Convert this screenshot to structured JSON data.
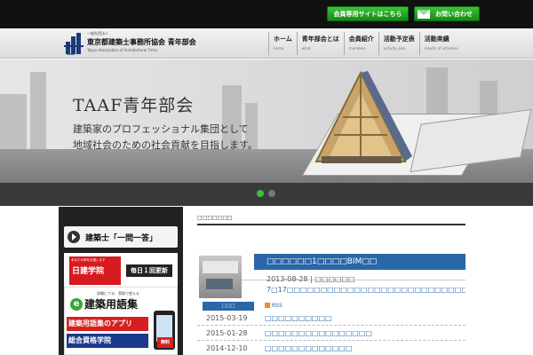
{
  "topbar": {
    "members_label": "会員専用サイトはこちら",
    "contact_label": "お問い合わせ"
  },
  "header": {
    "logo_small": "一般社団法人",
    "logo_title": "東京都建築士事務所協会  青年部会",
    "logo_english": "Tokyo Association of Architectural Firms",
    "logo_abbr": "TAAF"
  },
  "nav": {
    "items": [
      {
        "jp": "ホーム",
        "en": "home"
      },
      {
        "jp": "青年部会とは",
        "en": "what"
      },
      {
        "jp": "会員紹介",
        "en": "members"
      },
      {
        "jp": "活動予定表",
        "en": "activity plan"
      },
      {
        "jp": "活動実績",
        "en": "results of activities"
      }
    ]
  },
  "hero": {
    "title": "TAAF青年部会",
    "subtitle_line1": "建築家のプロフェッショナル集団として",
    "subtitle_line2": "地域社会のための社会貢献を目指します。"
  },
  "sidebar": {
    "banner1_title": "建築士「一問一答」",
    "banner1_small": "あなたの夢を応援します",
    "banner1_brand": "日建学院",
    "banner1_daily": "毎日１回更新",
    "banner2_small": "試験にでる、実務で使える",
    "banner2_e": "e",
    "banner2_title": "建築用語集",
    "banner2_app": "建築用語集のアプリ",
    "banner2_school": "総合資格学院",
    "banner2_free": "無料"
  },
  "main": {
    "section_title": "□□□□□□□",
    "feature_title": "□□□□□□1□□□□BIM□□",
    "feature_date": "2013-08-28 | □□□□□□",
    "feature_desc": "7□17□□□□□□□□□□□□□□□□□□□□□□□□□□□□□□...",
    "list_head_label": "□□□",
    "rss_label": "RSS",
    "news": [
      {
        "date": "2015-03-19",
        "title": "□□□□□□□□□□"
      },
      {
        "date": "2015-01-28",
        "title": "□□□□□□□□□□□□□□□□"
      },
      {
        "date": "2014-12-10",
        "title": "□□□□□□□□□□□□□"
      }
    ]
  }
}
